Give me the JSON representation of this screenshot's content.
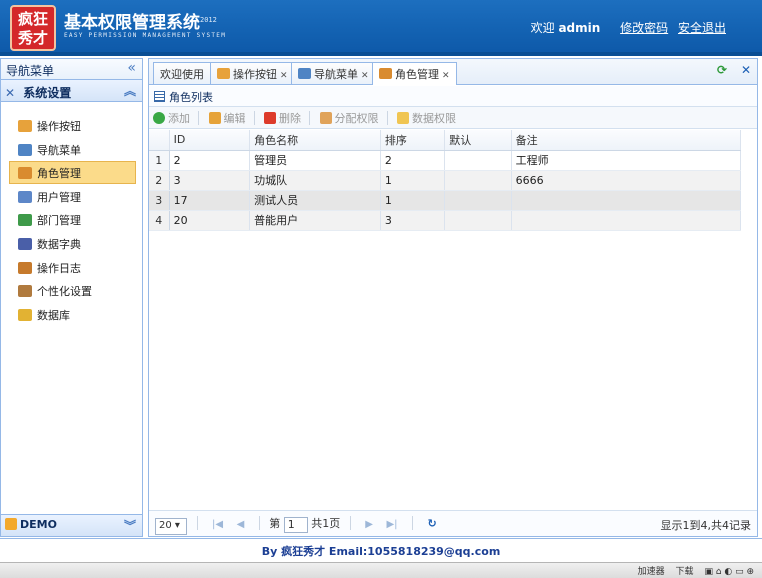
{
  "header": {
    "logo_text": [
      "疯狂",
      "秀才"
    ],
    "title": "基本权限管理系统",
    "year": "2012",
    "subtitle": "EASY PERMISSION MANAGEMENT SYSTEM",
    "welcome": "欢迎",
    "username": "admin",
    "change_password": "修改密码",
    "logout": "安全退出"
  },
  "sidebar": {
    "title": "导航菜单",
    "group": "系统设置",
    "items": [
      {
        "label": "操作按钮",
        "icon": "buttons-icon",
        "color": "#e7a23b"
      },
      {
        "label": "导航菜单",
        "icon": "menu-icon",
        "color": "#4f84c4"
      },
      {
        "label": "角色管理",
        "icon": "roles-icon",
        "color": "#d98b2f",
        "selected": true
      },
      {
        "label": "用户管理",
        "icon": "users-icon",
        "color": "#5d87c8"
      },
      {
        "label": "部门管理",
        "icon": "departments-icon",
        "color": "#3e9a4a"
      },
      {
        "label": "数据字典",
        "icon": "dictionary-icon",
        "color": "#4a5fa8"
      },
      {
        "label": "操作日志",
        "icon": "log-icon",
        "color": "#c67a2c"
      },
      {
        "label": "个性化设置",
        "icon": "wrench-icon",
        "color": "#b07a3e"
      },
      {
        "label": "数据库",
        "icon": "database-icon",
        "color": "#e2b233"
      }
    ],
    "footer": "DEMO"
  },
  "tabs": [
    {
      "label": "欢迎使用",
      "closable": false
    },
    {
      "label": "操作按钮",
      "closable": true
    },
    {
      "label": "导航菜单",
      "closable": true
    },
    {
      "label": "角色管理",
      "closable": true,
      "active": true
    }
  ],
  "panel": {
    "title": "角色列表"
  },
  "toolbar": {
    "add": "添加",
    "edit": "编辑",
    "delete": "删除",
    "assign": "分配权限",
    "data_perm": "数据权限"
  },
  "grid": {
    "columns": [
      "ID",
      "角色名称",
      "排序",
      "默认",
      "备注"
    ],
    "rows": [
      {
        "rn": "1",
        "id": "2",
        "name": "管理员",
        "sort": "2",
        "default": "",
        "remark": "工程师"
      },
      {
        "rn": "2",
        "id": "3",
        "name": "功城队",
        "sort": "1",
        "default": "",
        "remark": "6666"
      },
      {
        "rn": "3",
        "id": "17",
        "name": "测试人员",
        "sort": "1",
        "default": "",
        "remark": ""
      },
      {
        "rn": "4",
        "id": "20",
        "name": "普能用户",
        "sort": "3",
        "default": "",
        "remark": ""
      }
    ]
  },
  "pager": {
    "page_size": "20",
    "page_prefix": "第",
    "page": "1",
    "page_suffix": "共1页",
    "info": "显示1到4,共4记录"
  },
  "footer": {
    "text": "By 疯狂秀才 Email:1055818239@qq.com"
  },
  "statusbar": {
    "accelerator": "加速器",
    "download": "下载"
  },
  "colors": {
    "header_bg": "#1463b3",
    "border": "#95b8e7",
    "selected_nav": "#fbdb8a"
  }
}
